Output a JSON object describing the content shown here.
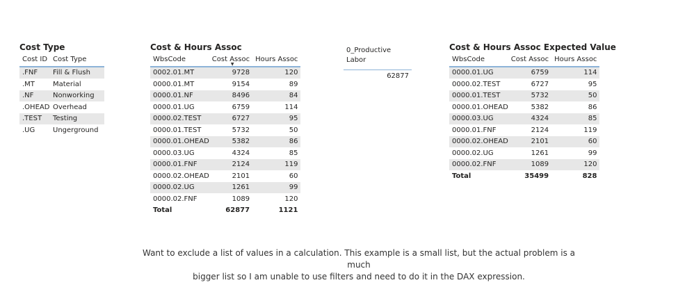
{
  "cost_type": {
    "title": "Cost Type",
    "columns": [
      "Cost ID",
      "Cost Type"
    ],
    "rows": [
      [
        ".FNF",
        "Fill & Flush"
      ],
      [
        ".MT",
        "Material"
      ],
      [
        ".NF",
        "Nonworking"
      ],
      [
        ".OHEAD",
        "Overhead"
      ],
      [
        ".TEST",
        "Testing"
      ],
      [
        ".UG",
        "Ungerground"
      ]
    ]
  },
  "cost_hours": {
    "title": "Cost & Hours Assoc",
    "columns": [
      "WbsCode",
      "Cost Assoc",
      "Hours Assoc"
    ],
    "rows": [
      [
        "0002.01.MT",
        "9728",
        "120"
      ],
      [
        "0000.01.MT",
        "9154",
        "89"
      ],
      [
        "0000.01.NF",
        "8496",
        "84"
      ],
      [
        "0000.01.UG",
        "6759",
        "114"
      ],
      [
        "0000.02.TEST",
        "6727",
        "95"
      ],
      [
        "0000.01.TEST",
        "5732",
        "50"
      ],
      [
        "0000.01.OHEAD",
        "5382",
        "86"
      ],
      [
        "0000.03.UG",
        "4324",
        "85"
      ],
      [
        "0000.01.FNF",
        "2124",
        "119"
      ],
      [
        "0000.02.OHEAD",
        "2101",
        "60"
      ],
      [
        "0000.02.UG",
        "1261",
        "99"
      ],
      [
        "0000.02.FNF",
        "1089",
        "120"
      ]
    ],
    "total": [
      "Total",
      "62877",
      "1121"
    ]
  },
  "card": {
    "label_line1": "0_Productive",
    "label_line2": "Labor",
    "value": "62877"
  },
  "expected": {
    "title": "Cost & Hours Assoc Expected Value",
    "columns": [
      "WbsCode",
      "Cost Assoc",
      "Hours Assoc"
    ],
    "rows": [
      [
        "0000.01.UG",
        "6759",
        "114"
      ],
      [
        "0000.02.TEST",
        "6727",
        "95"
      ],
      [
        "0000.01.TEST",
        "5732",
        "50"
      ],
      [
        "0000.01.OHEAD",
        "5382",
        "86"
      ],
      [
        "0000.03.UG",
        "4324",
        "85"
      ],
      [
        "0000.01.FNF",
        "2124",
        "119"
      ],
      [
        "0000.02.OHEAD",
        "2101",
        "60"
      ],
      [
        "0000.02.UG",
        "1261",
        "99"
      ],
      [
        "0000.02.FNF",
        "1089",
        "120"
      ]
    ],
    "total": [
      "Total",
      "35499",
      "828"
    ]
  },
  "note": {
    "line1": "Want to exclude a list of values in a calculation. This example is a small list, but the actual problem is a much",
    "line2": "bigger list so I am unable to use filters and need to do it in the DAX expression."
  },
  "colors": {
    "header_underline": "#8db3d8",
    "alt_row": "#e7e7e7"
  },
  "icons": {
    "sort": "sort-descending-icon"
  }
}
